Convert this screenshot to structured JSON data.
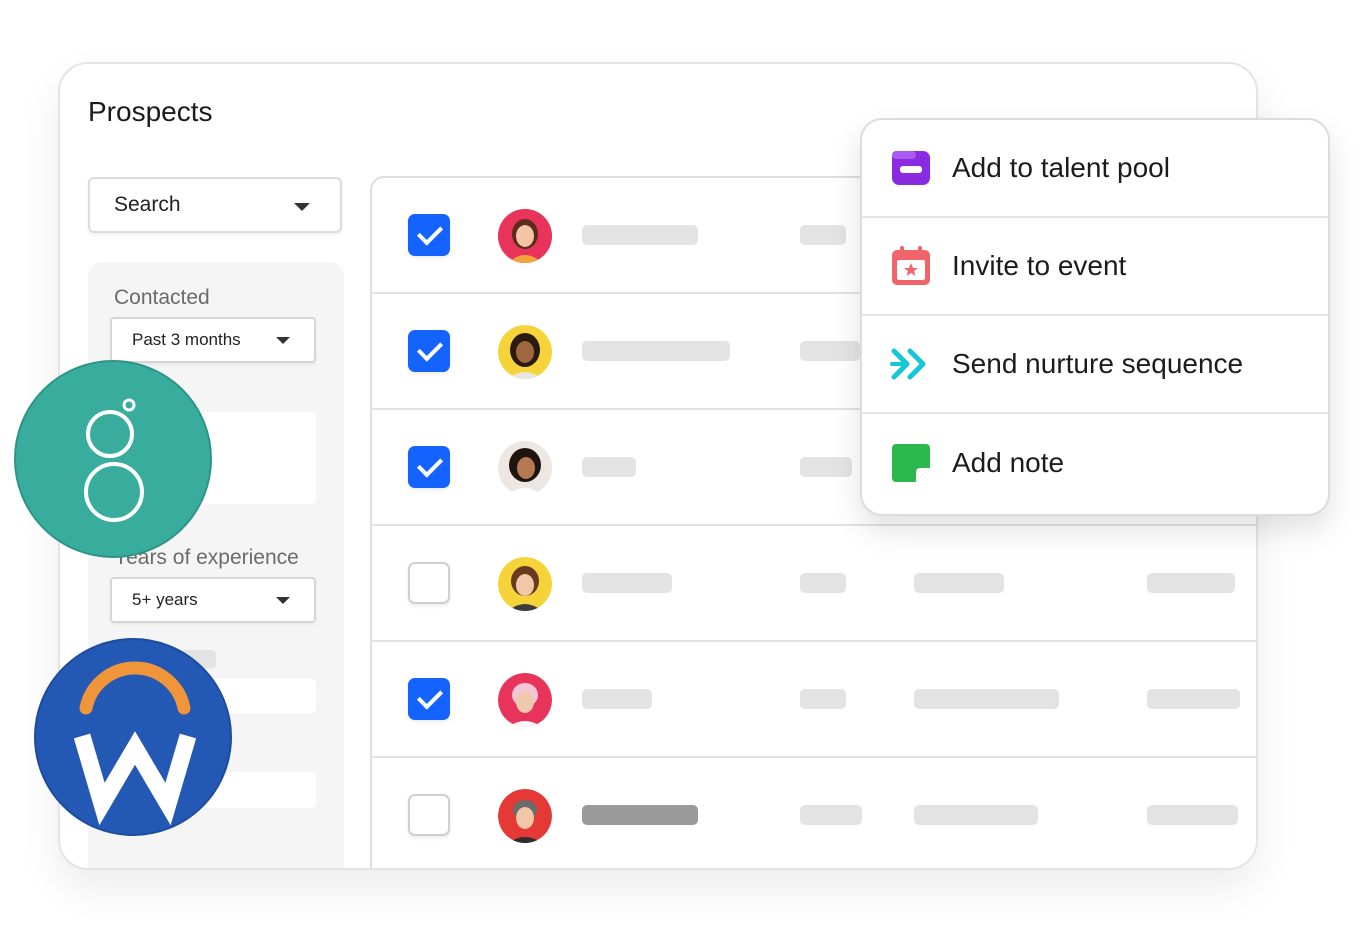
{
  "page_title": "Prospects",
  "search": {
    "value": "Search"
  },
  "filters": {
    "contacted": {
      "label": "Contacted",
      "value": "Past 3 months"
    },
    "experience": {
      "label": "Years of experience",
      "value": "5+ years"
    }
  },
  "rows": [
    {
      "checked": true
    },
    {
      "checked": true
    },
    {
      "checked": true
    },
    {
      "checked": false
    },
    {
      "checked": true
    },
    {
      "checked": false
    }
  ],
  "menu": {
    "items": [
      {
        "label": "Add to talent pool",
        "icon": "talent-pool-icon",
        "color": "#8a2be2"
      },
      {
        "label": "Invite to event",
        "icon": "calendar-icon",
        "color": "#f0646c"
      },
      {
        "label": "Send nurture sequence",
        "icon": "double-chevron-icon",
        "color": "#12c7d6"
      },
      {
        "label": "Add note",
        "icon": "note-icon",
        "color": "#2db84d"
      }
    ]
  },
  "colors": {
    "accent": "#1463ff",
    "greenhouse": "#38ad9e",
    "workday_blue": "#2359b4",
    "workday_orange": "#f0953a"
  }
}
